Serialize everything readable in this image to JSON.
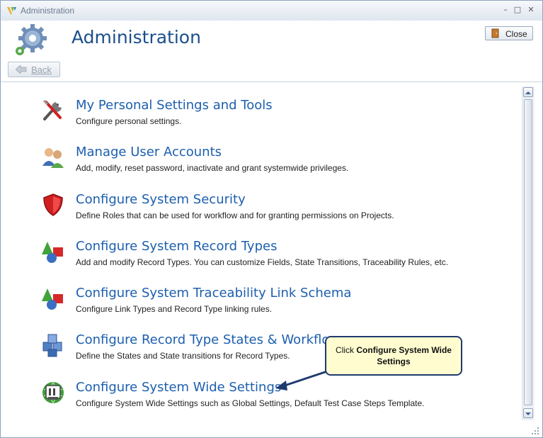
{
  "window": {
    "title": "Administration"
  },
  "header": {
    "title": "Administration",
    "close_label": "Close",
    "back_label": "Back"
  },
  "items": [
    {
      "title": "My Personal Settings and Tools",
      "desc": "Configure personal settings.",
      "icon": "tools-icon"
    },
    {
      "title": "Manage User Accounts",
      "desc": "Add, modify, reset password, inactivate and grant systemwide privileges.",
      "icon": "users-icon"
    },
    {
      "title": "Configure System Security",
      "desc": "Define Roles that can be used for workflow and for granting permissions on Projects.",
      "icon": "shield-icon"
    },
    {
      "title": "Configure System Record Types",
      "desc": "Add and modify Record Types. You can customize Fields, State Transitions, Traceability Rules, etc.",
      "icon": "shapes-icon"
    },
    {
      "title": "Configure System Traceability Link Schema",
      "desc": "Configure Link Types and Record Type linking rules.",
      "icon": "shapes-icon"
    },
    {
      "title": "Configure Record Type States & Workflow",
      "desc": "Define the States and State transitions for Record Types.",
      "icon": "cubes-icon"
    },
    {
      "title": "Configure System Wide Settings",
      "desc": "Configure System Wide Settings such as Global Settings, Default Test Case Steps Template.",
      "icon": "globe-settings-icon"
    }
  ],
  "callout": {
    "prefix": "Click ",
    "bold": "Configure System Wide Settings"
  },
  "colors": {
    "link": "#1c5fae",
    "title": "#1b4f8c",
    "callout_bg": "#fffdd0",
    "callout_border": "#1e3a6e"
  }
}
